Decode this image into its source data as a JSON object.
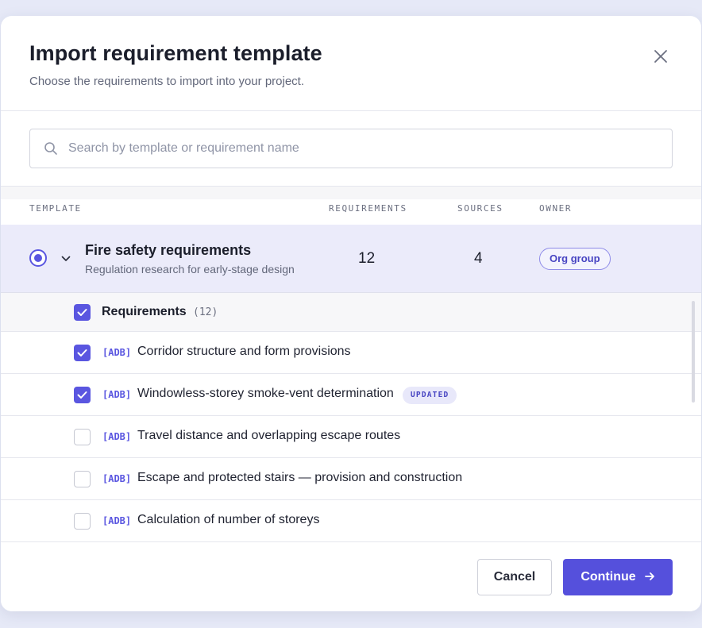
{
  "dialog": {
    "title": "Import requirement template",
    "subtitle": "Choose the requirements to import into your project.",
    "close_icon": "close-icon"
  },
  "search": {
    "placeholder": "Search by template or requirement name",
    "value": "",
    "icon": "search-icon"
  },
  "table": {
    "columns": [
      "TEMPLATE",
      "REQUIREMENTS",
      "SOURCES",
      "OWNER"
    ]
  },
  "template": {
    "selected": true,
    "expanded": true,
    "name": "Fire safety requirements",
    "description": "Regulation research for early-stage design",
    "requirements": "12",
    "sources": "4",
    "owner": "Org group"
  },
  "group": {
    "label": "Requirements",
    "count": "(12)",
    "checked": true
  },
  "requirements": [
    {
      "tag": "[ADB]",
      "label": "Corridor structure and form provisions",
      "checked": true,
      "badge": ""
    },
    {
      "tag": "[ADB]",
      "label": "Windowless-storey smoke-vent determination",
      "checked": true,
      "badge": "UPDATED"
    },
    {
      "tag": "[ADB]",
      "label": "Travel distance and overlapping escape routes",
      "checked": false,
      "badge": ""
    },
    {
      "tag": "[ADB]",
      "label": "Escape and protected stairs — provision and construction",
      "checked": false,
      "badge": ""
    },
    {
      "tag": "[ADB]",
      "label": "Calculation of number of storeys",
      "checked": false,
      "badge": ""
    }
  ],
  "footer": {
    "cancel_label": "Cancel",
    "continue_label": "Continue"
  },
  "colors": {
    "accent": "#5550dc",
    "selected_row": "#ebebfa",
    "background": "#e6e9f7"
  }
}
